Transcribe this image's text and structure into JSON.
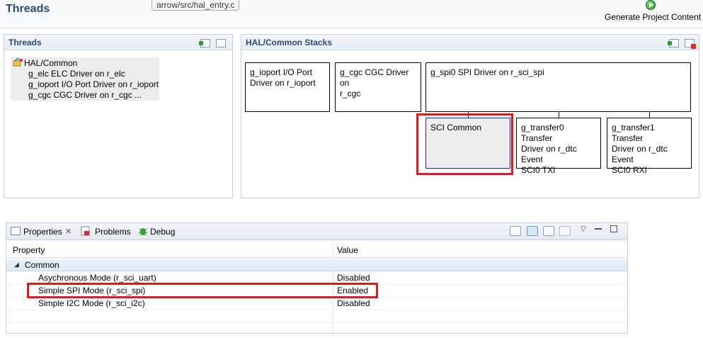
{
  "header": {
    "title": "Threads",
    "file_tab": "arrow/src/hal_entry.c",
    "generate_label": "Generate Project Content"
  },
  "threads_panel": {
    "title": "Threads",
    "tree": {
      "root": "HAL/Common",
      "children": [
        "g_elc ELC Driver on r_elc",
        "g_ioport I/O Port Driver on r_ioport",
        "g_cgc CGC Driver on r_cgc ..."
      ]
    }
  },
  "stacks_panel": {
    "title": "HAL/Common Stacks",
    "boxes": {
      "ioport": [
        "g_ioport I/O Port",
        "Driver on r_ioport"
      ],
      "cgc": [
        "g_cgc CGC Driver on",
        "r_cgc"
      ],
      "spi0": [
        "g_spi0 SPI Driver on r_sci_spi"
      ],
      "sci_common": [
        "SCI Common"
      ],
      "transfer0": [
        "g_transfer0 Transfer",
        "Driver on r_dtc Event",
        "SCI0 TXI"
      ],
      "transfer1": [
        "g_transfer1 Transfer",
        "Driver on r_dtc Event",
        "SCI0 RXI"
      ]
    }
  },
  "properties_panel": {
    "tabs": [
      {
        "label": "Properties",
        "icon": "properties-icon"
      },
      {
        "label": "Problems",
        "icon": "problems-icon"
      },
      {
        "label": "Debug",
        "icon": "debug-icon"
      }
    ],
    "close_glyph": "✕",
    "columns": {
      "property": "Property",
      "value": "Value"
    },
    "group": {
      "expander": "◢",
      "label": "Common"
    },
    "rows": [
      {
        "property": "Asychronous Mode (r_sci_uart)",
        "value": "Disabled"
      },
      {
        "property": "Simple SPI Mode (r_sci_spi)",
        "value": "Enabled"
      },
      {
        "property": "Simple I2C Mode (r_sci_i2c)",
        "value": "Disabled"
      }
    ],
    "view_menu_glyph": "▽"
  },
  "colors": {
    "title_blue": "#2b4a79",
    "highlight_red": "#e01b1b",
    "selected_border": "#1b24a8"
  }
}
